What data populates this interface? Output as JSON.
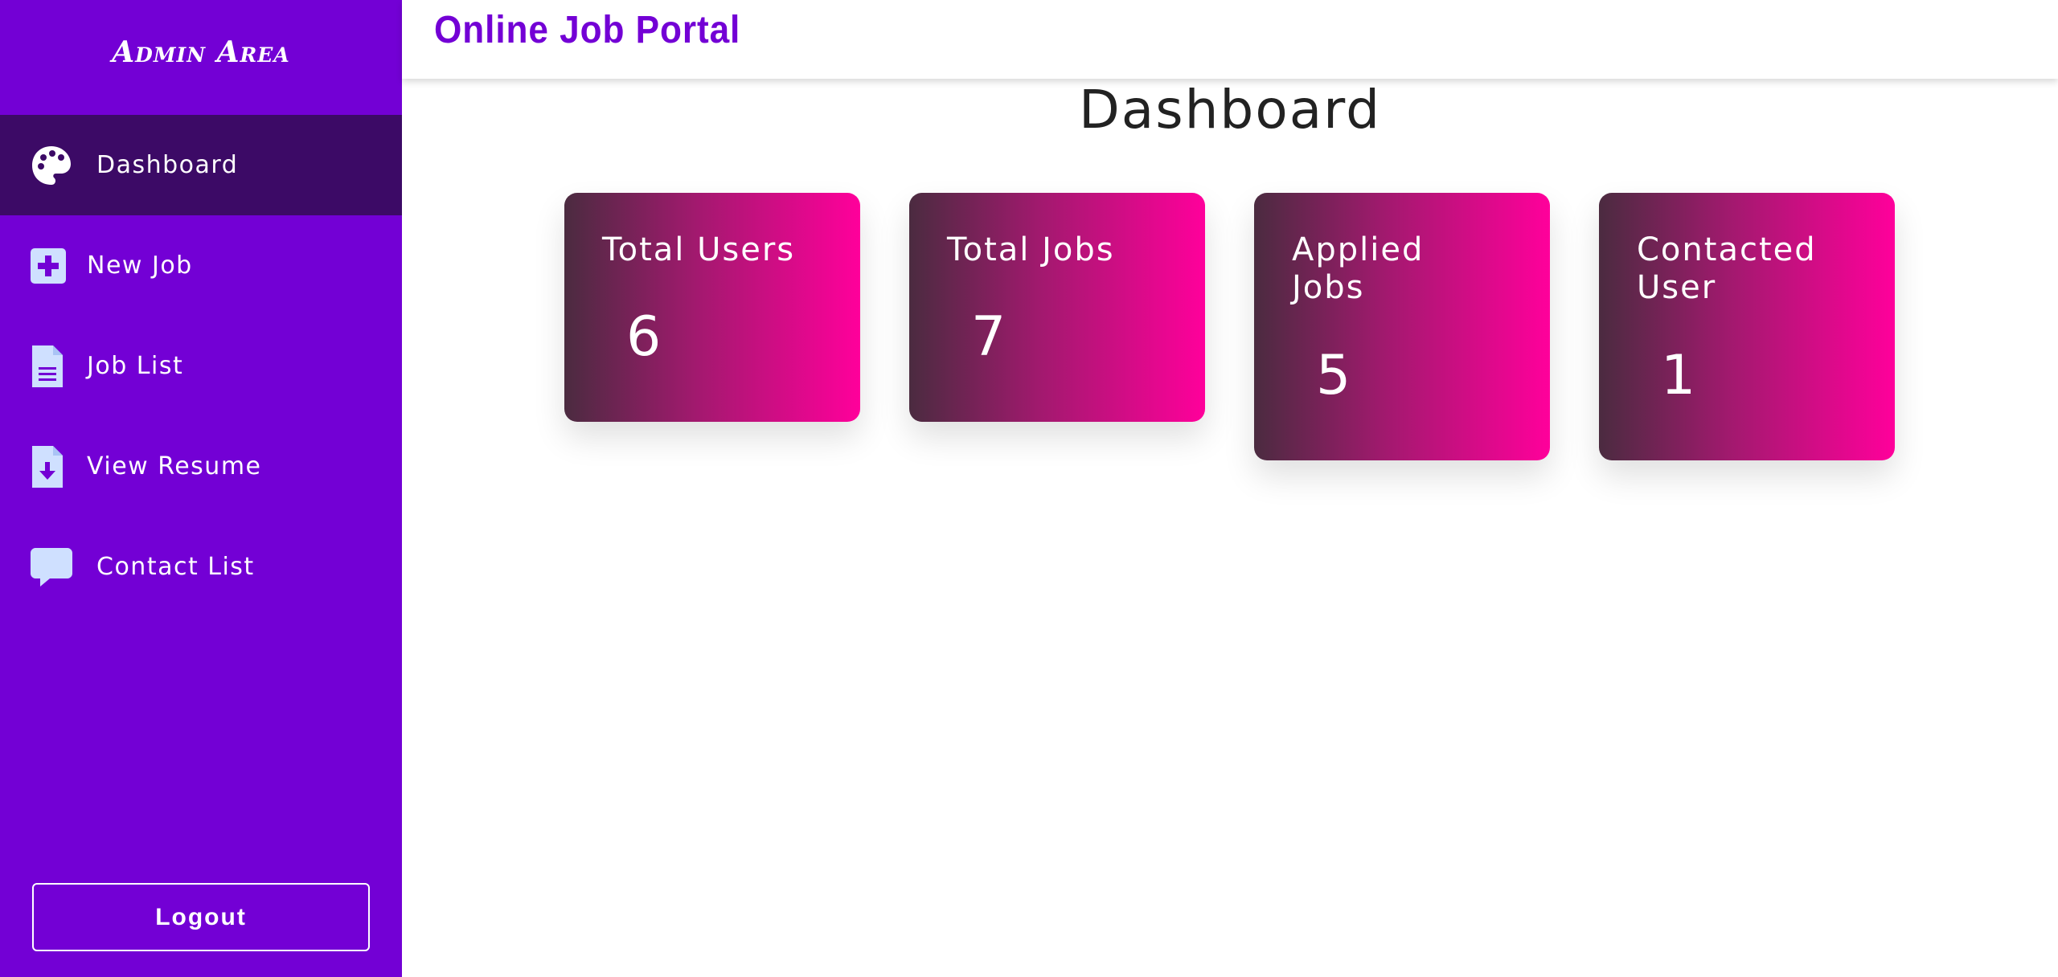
{
  "sidebar": {
    "brand": "Admin Area",
    "items": [
      {
        "label": "Dashboard",
        "icon": "palette-icon",
        "active": true
      },
      {
        "label": "New Job",
        "icon": "plus-square-icon",
        "active": false
      },
      {
        "label": "Job List",
        "icon": "document-icon",
        "active": false
      },
      {
        "label": "View Resume",
        "icon": "file-download-icon",
        "active": false
      },
      {
        "label": "Contact List",
        "icon": "chat-bubble-icon",
        "active": false
      }
    ],
    "logout_label": "Logout"
  },
  "header": {
    "title": "Online Job Portal"
  },
  "main": {
    "title": "Dashboard",
    "cards": [
      {
        "label": "Total Users",
        "value": "6"
      },
      {
        "label": "Total Jobs",
        "value": "7"
      },
      {
        "label": "Applied Jobs",
        "value": "5"
      },
      {
        "label": "Contacted User",
        "value": "1"
      }
    ]
  },
  "colors": {
    "sidebar": "#7300d5",
    "sidebar_active": "#3c0a66",
    "accent": "#7300d5",
    "card_gradient_start": "#4b2b40",
    "card_gradient_end": "#ff009b",
    "icon_tint": "#cfe0ff"
  }
}
